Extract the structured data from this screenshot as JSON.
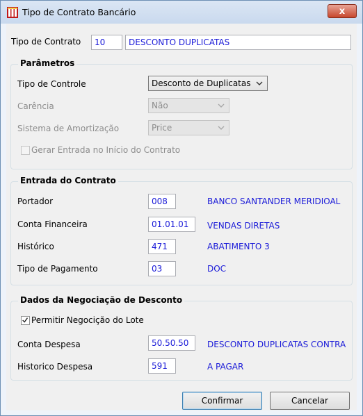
{
  "window": {
    "title": "Tipo de Contrato Bancário",
    "close_glyph": "x"
  },
  "header": {
    "tipo_contrato_label": "Tipo de Contrato",
    "tipo_contrato_code": "10",
    "tipo_contrato_desc": "DESCONTO DUPLICATAS"
  },
  "parametros": {
    "title": "Parâmetros",
    "tipo_controle_label": "Tipo de Controle",
    "tipo_controle_value": "Desconto de Duplicatas",
    "carencia_label": "Carência",
    "carencia_value": "Não",
    "amortizacao_label": "Sistema de Amortização",
    "amortizacao_value": "Price",
    "gerar_entrada_label": "Gerar Entrada no Início do Contrato",
    "gerar_entrada_checked": false
  },
  "entrada": {
    "title": "Entrada do Contrato",
    "rows": [
      {
        "label": "Portador",
        "code": "008",
        "desc": "BANCO SANTANDER MERIDIOAL"
      },
      {
        "label": "Conta Financeira",
        "code": "01.01.01",
        "desc": "VENDAS DIRETAS"
      },
      {
        "label": "Histórico",
        "code": "471",
        "desc": "ABATIMENTO 3"
      },
      {
        "label": "Tipo de Pagamento",
        "code": "03",
        "desc": "DOC"
      }
    ]
  },
  "negociacao": {
    "title": "Dados da Negociação de Desconto",
    "permitir_label": "Permitir Negocição do Lote",
    "permitir_checked": true,
    "conta_despesa_label": "Conta Despesa",
    "conta_despesa_code": "50.50.50",
    "conta_despesa_desc": "DESCONTO DUPLICATAS CONTRA",
    "historico_despesa_label": "Historico Despesa",
    "historico_despesa_code": "591",
    "historico_despesa_desc": "A PAGAR"
  },
  "buttons": {
    "confirm_label": "Confirmar",
    "cancel_label": "Cancelar"
  },
  "colors": {
    "value_text": "#1a1ad8",
    "title_bar": "#c9d9ee",
    "close_button": "#c7472d"
  },
  "icons": {
    "app": "app-logo-icon",
    "close": "close-icon",
    "dropdown": "chevron-down-icon",
    "check": "checkmark-icon"
  }
}
